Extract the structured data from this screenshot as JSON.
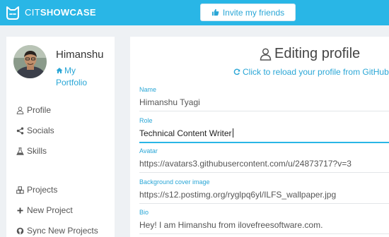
{
  "header": {
    "brand_prefix": "CIT",
    "brand_suffix": "SHOWCASE",
    "invite_label": "Invite my friends",
    "bar_color": "#29b6e6"
  },
  "sidebar": {
    "user_name": "Himanshu",
    "portfolio_label": "My Portfolio",
    "items": [
      {
        "label": "Profile",
        "icon": "user-icon"
      },
      {
        "label": "Socials",
        "icon": "share-icon"
      },
      {
        "label": "Skills",
        "icon": "flask-icon"
      },
      {
        "label": "Projects",
        "icon": "cubes-icon"
      },
      {
        "label": "New Project",
        "icon": "plus-icon"
      },
      {
        "label": "Sync New Projects",
        "icon": "github-icon"
      }
    ]
  },
  "main": {
    "title": "Editing profile",
    "reload_label": "Click to reload your profile from GitHub",
    "fields": [
      {
        "label": "Name",
        "value": "Himanshu Tyagi"
      },
      {
        "label": "Role",
        "value": "Technical Content Writer"
      },
      {
        "label": "Avatar",
        "value": "https://avatars3.githubusercontent.com/u/24873717?v=3"
      },
      {
        "label": "Background cover image",
        "value": "https://s12.postimg.org/ryglpq6yl/ILFS_wallpaper.jpg"
      },
      {
        "label": "Bio",
        "value": "Hey! I am Himanshu from ilovefreesoftware.com."
      }
    ]
  }
}
